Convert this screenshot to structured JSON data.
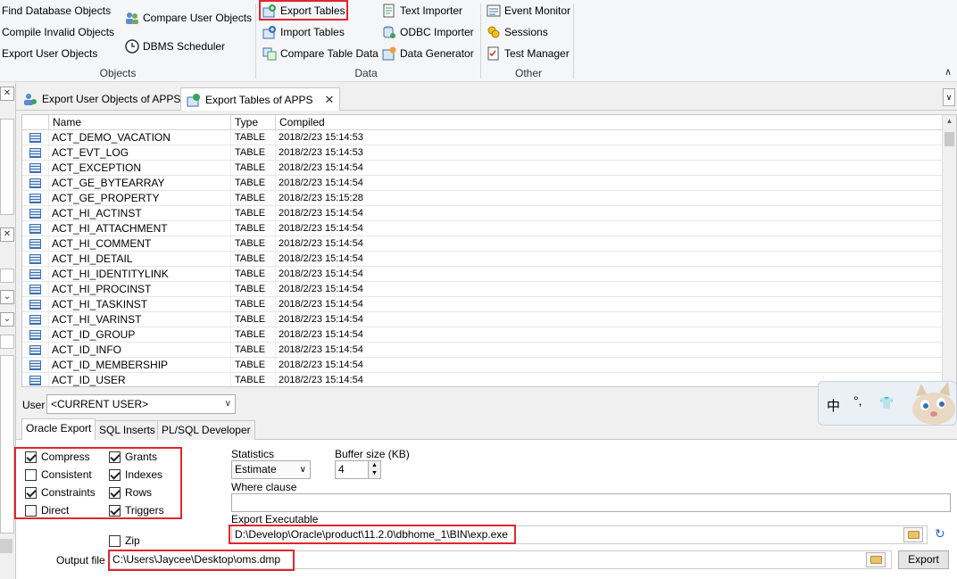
{
  "ribbon": {
    "objects": {
      "find_db_objects": "Find Database Objects",
      "compile_invalid": "Compile Invalid Objects",
      "export_user_objects": "Export User Objects",
      "compare_user_objects": "Compare User Objects",
      "dbms_scheduler": "DBMS Scheduler",
      "group_label": "Objects"
    },
    "data": {
      "export_tables": "Export Tables",
      "import_tables": "Import Tables",
      "compare_table_data": "Compare Table Data",
      "text_importer": "Text Importer",
      "odbc_importer": "ODBC Importer",
      "data_generator": "Data Generator",
      "group_label": "Data"
    },
    "other": {
      "event_monitor": "Event Monitor",
      "sessions": "Sessions",
      "test_manager": "Test Manager",
      "group_label": "Other"
    }
  },
  "tabs": [
    {
      "label": "Export User Objects of APPS"
    },
    {
      "label": "Export Tables of APPS"
    }
  ],
  "grid": {
    "columns": [
      "Name",
      "Type",
      "Compiled"
    ],
    "rows": [
      {
        "name": "ACT_DEMO_VACATION",
        "type": "TABLE",
        "compiled": "2018/2/23 15:14:53"
      },
      {
        "name": "ACT_EVT_LOG",
        "type": "TABLE",
        "compiled": "2018/2/23 15:14:53"
      },
      {
        "name": "ACT_EXCEPTION",
        "type": "TABLE",
        "compiled": "2018/2/23 15:14:54"
      },
      {
        "name": "ACT_GE_BYTEARRAY",
        "type": "TABLE",
        "compiled": "2018/2/23 15:14:54"
      },
      {
        "name": "ACT_GE_PROPERTY",
        "type": "TABLE",
        "compiled": "2018/2/23 15:15:28"
      },
      {
        "name": "ACT_HI_ACTINST",
        "type": "TABLE",
        "compiled": "2018/2/23 15:14:54"
      },
      {
        "name": "ACT_HI_ATTACHMENT",
        "type": "TABLE",
        "compiled": "2018/2/23 15:14:54"
      },
      {
        "name": "ACT_HI_COMMENT",
        "type": "TABLE",
        "compiled": "2018/2/23 15:14:54"
      },
      {
        "name": "ACT_HI_DETAIL",
        "type": "TABLE",
        "compiled": "2018/2/23 15:14:54"
      },
      {
        "name": "ACT_HI_IDENTITYLINK",
        "type": "TABLE",
        "compiled": "2018/2/23 15:14:54"
      },
      {
        "name": "ACT_HI_PROCINST",
        "type": "TABLE",
        "compiled": "2018/2/23 15:14:54"
      },
      {
        "name": "ACT_HI_TASKINST",
        "type": "TABLE",
        "compiled": "2018/2/23 15:14:54"
      },
      {
        "name": "ACT_HI_VARINST",
        "type": "TABLE",
        "compiled": "2018/2/23 15:14:54"
      },
      {
        "name": "ACT_ID_GROUP",
        "type": "TABLE",
        "compiled": "2018/2/23 15:14:54"
      },
      {
        "name": "ACT_ID_INFO",
        "type": "TABLE",
        "compiled": "2018/2/23 15:14:54"
      },
      {
        "name": "ACT_ID_MEMBERSHIP",
        "type": "TABLE",
        "compiled": "2018/2/23 15:14:54"
      },
      {
        "name": "ACT_ID_USER",
        "type": "TABLE",
        "compiled": "2018/2/23 15:14:54"
      }
    ]
  },
  "user": {
    "label": "User",
    "value": "<CURRENT USER>"
  },
  "option_tabs": [
    "Oracle Export",
    "SQL Inserts",
    "PL/SQL Developer"
  ],
  "options": {
    "compress": {
      "label": "Compress",
      "checked": true
    },
    "consistent": {
      "label": "Consistent",
      "checked": false
    },
    "constraints": {
      "label": "Constraints",
      "checked": true
    },
    "direct": {
      "label": "Direct",
      "checked": false
    },
    "grants": {
      "label": "Grants",
      "checked": true
    },
    "indexes": {
      "label": "Indexes",
      "checked": true
    },
    "rows": {
      "label": "Rows",
      "checked": true
    },
    "triggers": {
      "label": "Triggers",
      "checked": true
    },
    "zip": {
      "label": "Zip",
      "checked": false
    }
  },
  "statistics": {
    "label": "Statistics",
    "value": "Estimate"
  },
  "buffer": {
    "label": "Buffer size (KB)",
    "value": "4"
  },
  "where": {
    "label": "Where clause",
    "value": ""
  },
  "executable": {
    "label": "Export Executable",
    "value": "D:\\Develop\\Oracle\\product\\11.2.0\\dbhome_1\\BIN\\exp.exe"
  },
  "output": {
    "label": "Output file",
    "value": "C:\\Users\\Jaycee\\Desktop\\oms.dmp"
  },
  "export_button": "Export",
  "ime": {
    "lang": "中",
    "punct": "°,",
    "skin": "👕"
  },
  "colors": {
    "highlight": "#e0262e",
    "accent": "#2a6ab8"
  }
}
